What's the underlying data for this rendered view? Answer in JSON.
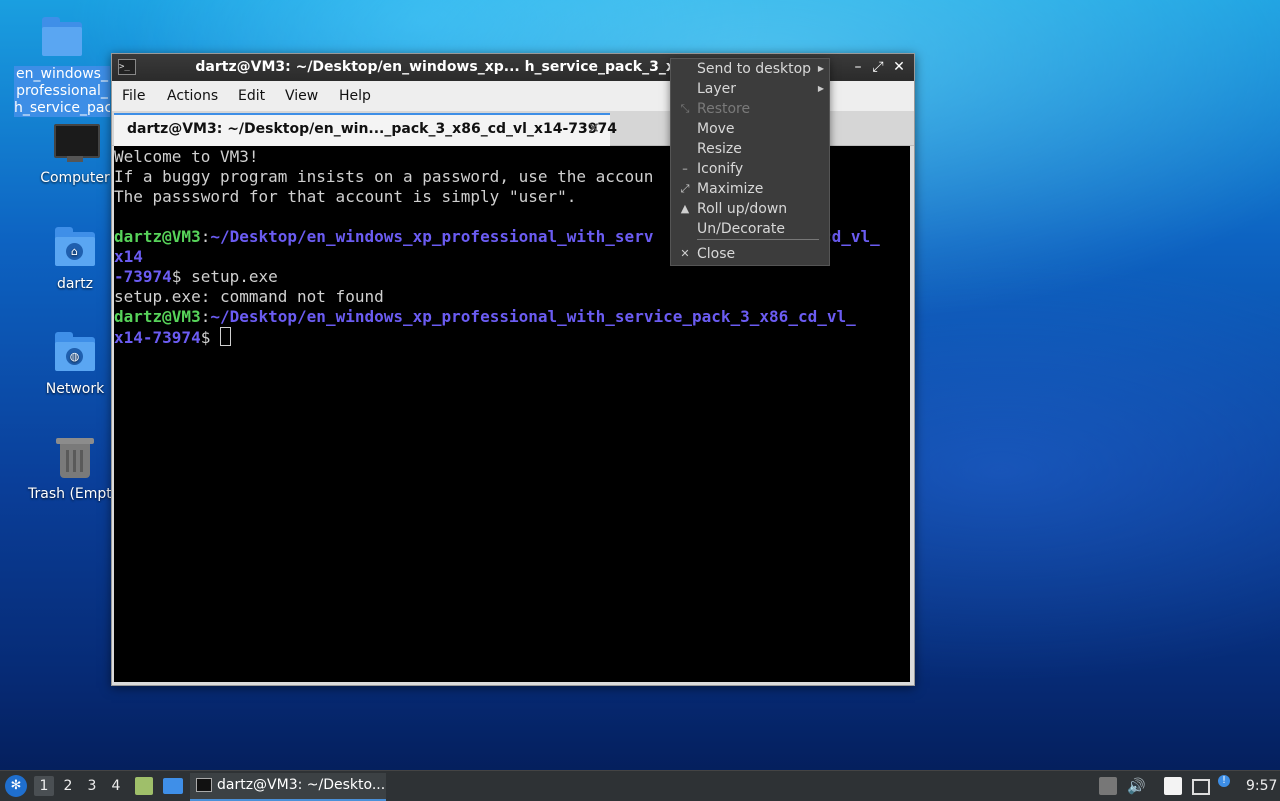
{
  "desktop": {
    "icons": [
      {
        "label_lines": [
          "en_windows_",
          "professional_",
          "h_service_pac"
        ],
        "icon": "folder-icon"
      },
      {
        "label": "Computer",
        "icon": "computer-icon"
      },
      {
        "label": "dartz",
        "icon": "home-folder-icon"
      },
      {
        "label": "Network",
        "icon": "network-folder-icon"
      },
      {
        "label": "Trash (Empt",
        "icon": "trash-icon"
      }
    ]
  },
  "window": {
    "title": "dartz@VM3: ~/Desktop/en_windows_xp... h_service_pack_3_x86_cd_vl_x14-73974",
    "menu": [
      "File",
      "Actions",
      "Edit",
      "View",
      "Help"
    ],
    "tab_label": "dartz@VM3: ~/Desktop/en_win..._pack_3_x86_cd_vl_x14-73974",
    "tab_close": "✕",
    "terminal": {
      "welcome": "Welcome to VM3!",
      "line2": "If a buggy program insists on a password, use the accoun",
      "line3": "The passsword for that account is simply \"user\".",
      "prompt_user": "dartz@VM3",
      "prompt_sep": ":",
      "path_1a": "~/Desktop/en_windows_xp_professional_with_serv",
      "path_1b": "cd_vl_",
      "path_1c": "x14",
      "path_1d": "-73974",
      "dollar_cmd": "$ setup.exe",
      "error": "setup.exe: command not found",
      "path_2a": "~/Desktop/en_windows_xp_professional_with_service_pack_3_x86_cd_vl_",
      "path_2b": "x14-73974",
      "dollar": "$ "
    }
  },
  "context_menu": {
    "items": [
      {
        "label": "Send to desktop",
        "icon": "",
        "submenu": true,
        "enabled": true
      },
      {
        "label": "Layer",
        "icon": "",
        "submenu": true,
        "enabled": true
      },
      {
        "label": "Restore",
        "icon": "restore-icon",
        "submenu": false,
        "enabled": false
      },
      {
        "label": "Move",
        "icon": "",
        "submenu": false,
        "enabled": true
      },
      {
        "label": "Resize",
        "icon": "",
        "submenu": false,
        "enabled": true
      },
      {
        "label": "Iconify",
        "icon": "iconify-icon",
        "submenu": false,
        "enabled": true
      },
      {
        "label": "Maximize",
        "icon": "maximize-icon",
        "submenu": false,
        "enabled": true
      },
      {
        "label": "Roll up/down",
        "icon": "rollup-icon",
        "submenu": false,
        "enabled": true
      },
      {
        "label": "Un/Decorate",
        "icon": "",
        "submenu": false,
        "enabled": true
      },
      {
        "label": "Close",
        "icon": "close-icon",
        "submenu": false,
        "enabled": true
      }
    ]
  },
  "taskbar": {
    "desktops": [
      "1",
      "2",
      "3",
      "4"
    ],
    "task_label": "dartz@VM3: ~/Deskto...",
    "clock": "9:57"
  },
  "colors": {
    "prompt_user": "#57d35a",
    "prompt_path": "#6b5cf2",
    "selection": "#3d8ee6"
  }
}
